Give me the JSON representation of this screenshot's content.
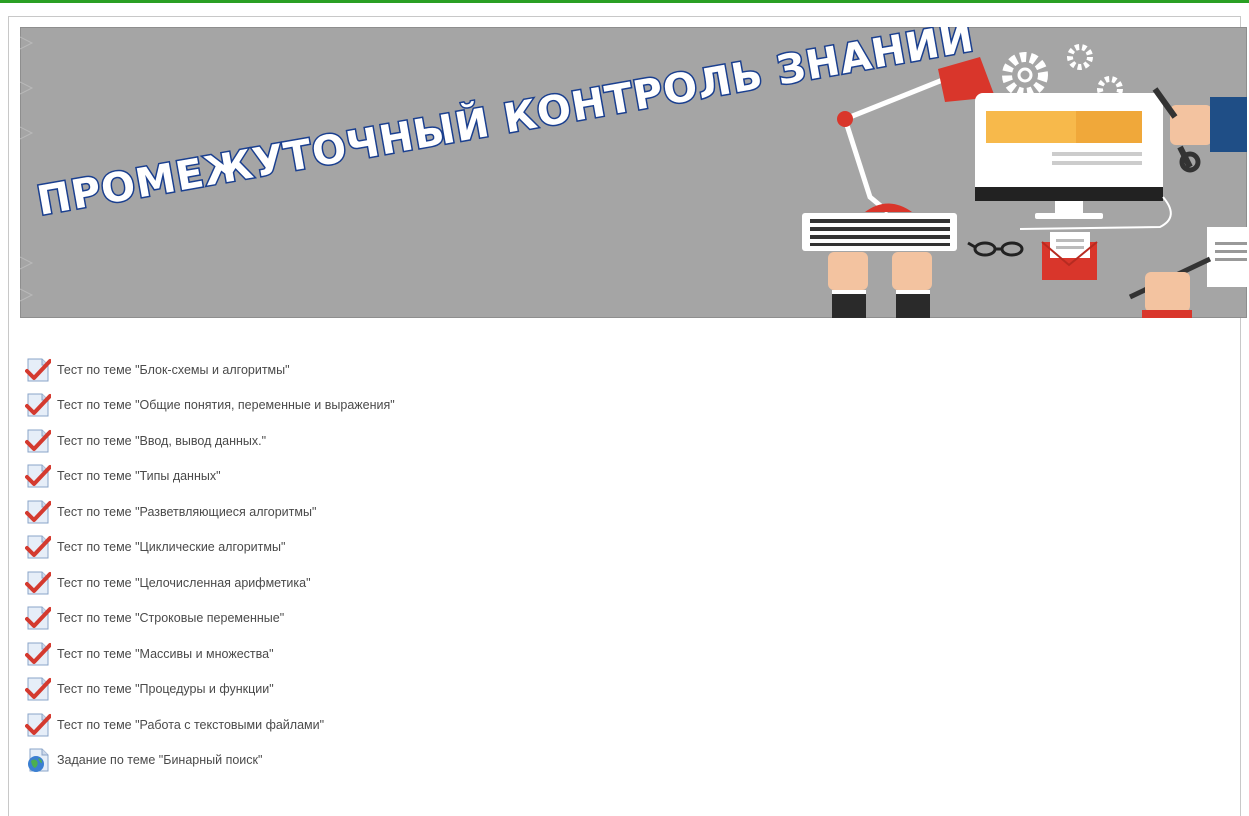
{
  "banner": {
    "title": "ПРОМЕЖУТОЧНЫЙ КОНТРОЛЬ ЗНАНИЙ",
    "background_color": "#a5a5a5",
    "title_fill": "#ffffff",
    "title_outline": "#1a3f8f"
  },
  "items": [
    {
      "label": "Тест по теме \"Блок-схемы и алгоритмы\"",
      "icon": "quiz-checkmark-icon"
    },
    {
      "label": "Тест по теме \"Общие понятия, переменные и выражения\"",
      "icon": "quiz-checkmark-icon"
    },
    {
      "label": "Тест по теме \"Ввод, вывод данных.\"",
      "icon": "quiz-checkmark-icon"
    },
    {
      "label": "Тест по теме \"Типы данных\"",
      "icon": "quiz-checkmark-icon"
    },
    {
      "label": "Тест по теме \"Разветвляющиеся алгоритмы\"",
      "icon": "quiz-checkmark-icon"
    },
    {
      "label": "Тест по теме \"Циклические алгоритмы\"",
      "icon": "quiz-checkmark-icon"
    },
    {
      "label": "Тест по теме \"Целочисленная арифметика\"",
      "icon": "quiz-checkmark-icon"
    },
    {
      "label": "Тест по теме \"Строковые переменные\"",
      "icon": "quiz-checkmark-icon"
    },
    {
      "label": "Тест по теме \"Массивы и множества\"",
      "icon": "quiz-checkmark-icon"
    },
    {
      "label": "Тест по теме \"Процедуры и функции\"",
      "icon": "quiz-checkmark-icon"
    },
    {
      "label": "Тест по теме \"Работа с текстовыми файлами\"",
      "icon": "quiz-checkmark-icon"
    },
    {
      "label": "Задание по теме \"Бинарный поиск\"",
      "icon": "assignment-globe-icon"
    }
  ],
  "colors": {
    "accent_green": "#2aa024",
    "check_red": "#d43a2f",
    "text": "#4a4a4a"
  }
}
